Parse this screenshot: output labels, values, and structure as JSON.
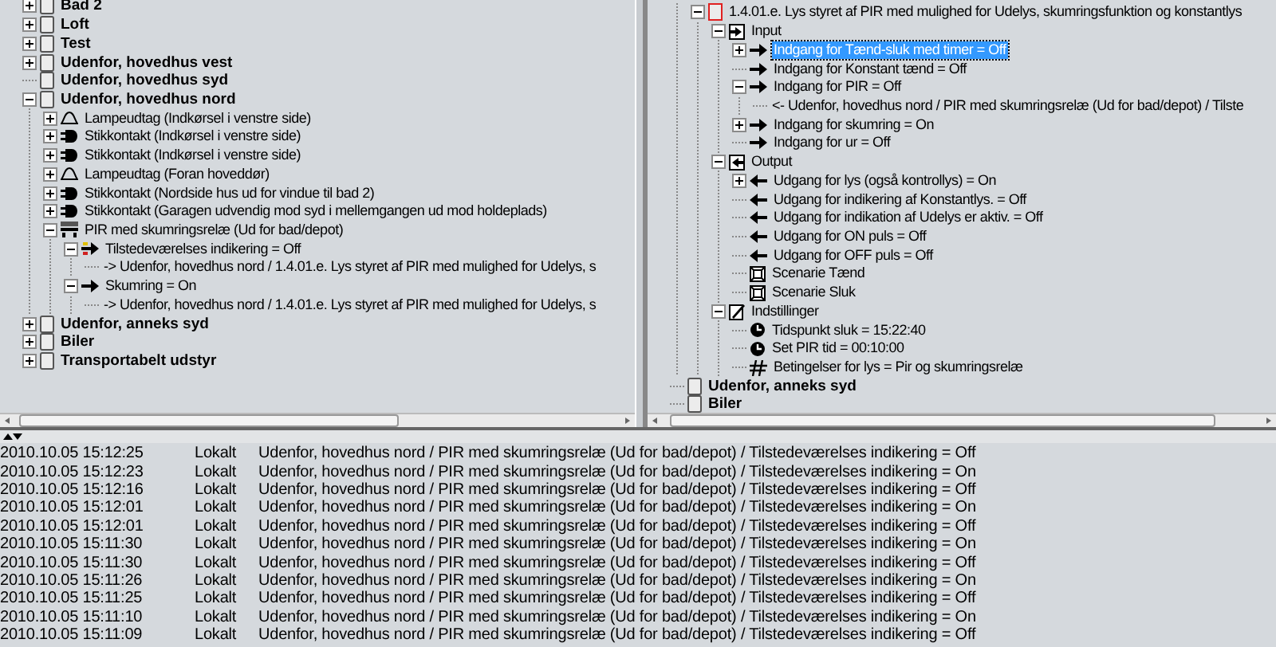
{
  "left_tree": [
    {
      "kind": "room",
      "label": "Bad 2",
      "expanded": false,
      "selected": false
    },
    {
      "kind": "room",
      "label": "Loft",
      "expanded": false,
      "selected": false
    },
    {
      "kind": "room",
      "label": "Test",
      "expanded": false,
      "selected": false
    },
    {
      "kind": "room",
      "label": "Udenfor, hovedhus vest",
      "expanded": false,
      "selected": false
    },
    {
      "kind": "room",
      "label": "Udenfor, hovedhus syd",
      "selected": false
    },
    {
      "kind": "room",
      "label": "Udenfor, hovedhus nord",
      "expanded": true,
      "selected": false,
      "children": [
        {
          "kind": "lamp",
          "label": "Lampeudtag (Indkørsel i venstre side)",
          "expanded": false,
          "selected": false
        },
        {
          "kind": "socket",
          "label": "Stikkontakt (Indkørsel i venstre side)",
          "expanded": false,
          "selected": false
        },
        {
          "kind": "socket",
          "label": "Stikkontakt (Indkørsel i venstre side)",
          "expanded": false,
          "selected": false
        },
        {
          "kind": "lamp",
          "label": "Lampeudtag (Foran hoveddør)",
          "expanded": false,
          "selected": false
        },
        {
          "kind": "socket",
          "label": "Stikkontakt (Nordside hus ud for vindue til bad 2)",
          "expanded": false,
          "selected": false
        },
        {
          "kind": "socket",
          "label": "Stikkontakt (Garagen udvendig mod syd i mellemgangen ud mod holdeplads)",
          "expanded": false,
          "selected": false
        },
        {
          "kind": "sensor",
          "label": "PIR med skumringsrelæ (Ud for bad/depot)",
          "expanded": true,
          "selected": false,
          "children": [
            {
              "kind": "presence",
              "label": "Tilstedeværelses indikering = Off",
              "expanded": true,
              "selected": false,
              "children": [
                {
                  "label": "-> Udenfor, hovedhus nord / 1.4.01.e. Lys styret af PIR med mulighed for Udelys, s",
                  "selected": false
                }
              ]
            },
            {
              "kind": "input",
              "label": "Skumring = On",
              "expanded": true,
              "selected": false,
              "children": [
                {
                  "label": "-> Udenfor, hovedhus nord / 1.4.01.e. Lys styret af PIR med mulighed for Udelys, s",
                  "selected": false
                }
              ]
            }
          ]
        }
      ]
    },
    {
      "kind": "room",
      "label": "Udenfor, anneks syd",
      "expanded": false,
      "selected": false
    },
    {
      "kind": "room",
      "label": "Biler",
      "expanded": false,
      "selected": false
    },
    {
      "kind": "room",
      "label": "Transportabelt udstyr",
      "expanded": false,
      "selected": false
    }
  ],
  "right_tree": [
    {
      "children": [
        {
          "kind": "module",
          "label": "1.4.01.e. Lys styret af PIR med mulighed for Udelys, skumringsfunktion og konstantlys",
          "expanded": true,
          "selected": false,
          "children": [
            {
              "kind": "input-group",
              "label": "Input",
              "expanded": true,
              "selected": false,
              "children": [
                {
                  "kind": "input",
                  "label": "Indgang for Tænd-sluk med timer = Off",
                  "expanded": false,
                  "selected": true
                },
                {
                  "kind": "input",
                  "label": "Indgang for Konstant tænd = Off",
                  "selected": false
                },
                {
                  "kind": "input",
                  "label": "Indgang for PIR = Off",
                  "expanded": true,
                  "selected": false,
                  "children": [
                    {
                      "label": "<- Udenfor, hovedhus nord / PIR med skumringsrelæ (Ud for bad/depot) / Tilste",
                      "selected": false
                    }
                  ]
                },
                {
                  "kind": "input",
                  "label": "Indgang for skumring = On",
                  "expanded": false,
                  "selected": false
                },
                {
                  "kind": "input",
                  "label": "Indgang for ur = Off",
                  "selected": false
                }
              ]
            },
            {
              "kind": "output-group",
              "label": "Output",
              "expanded": true,
              "selected": false,
              "children": [
                {
                  "kind": "output",
                  "label": "Udgang for lys (også kontrollys) = On",
                  "expanded": false,
                  "selected": false
                },
                {
                  "kind": "output",
                  "label": "Udgang for indikering af Konstantlys. = Off",
                  "selected": false
                },
                {
                  "kind": "output",
                  "label": "Udgang for indikation af Udelys er aktiv. = Off",
                  "selected": false
                },
                {
                  "kind": "output",
                  "label": "Udgang for ON puls = Off",
                  "selected": false
                },
                {
                  "kind": "output",
                  "label": "Udgang for OFF puls = Off",
                  "selected": false
                },
                {
                  "kind": "scene",
                  "label": "Scenarie Tænd",
                  "selected": false
                },
                {
                  "kind": "scene",
                  "label": "Scenarie Sluk",
                  "selected": false
                }
              ]
            },
            {
              "kind": "settings",
              "label": "Indstillinger",
              "expanded": true,
              "selected": false,
              "children": [
                {
                  "kind": "timer",
                  "label": "Tidspunkt sluk = 15:22:40",
                  "selected": false
                },
                {
                  "kind": "timer",
                  "label": "Set PIR tid = 00:10:00",
                  "selected": false
                },
                {
                  "kind": "condition",
                  "label": "Betingelser for lys = Pir og skumringsrelæ",
                  "selected": false
                }
              ]
            }
          ]
        }
      ]
    },
    {
      "kind": "room",
      "label": "Udenfor, anneks syd",
      "selected": false
    },
    {
      "kind": "room",
      "label": "Biler",
      "selected": false
    }
  ],
  "log": [
    {
      "time": "2010.10.05 15:12:25",
      "source": "Lokalt",
      "message": "Udenfor, hovedhus nord / PIR med skumringsrelæ (Ud for bad/depot) / Tilstedeværelses indikering = Off"
    },
    {
      "time": "2010.10.05 15:12:23",
      "source": "Lokalt",
      "message": "Udenfor, hovedhus nord / PIR med skumringsrelæ (Ud for bad/depot) / Tilstedeværelses indikering = On"
    },
    {
      "time": "2010.10.05 15:12:16",
      "source": "Lokalt",
      "message": "Udenfor, hovedhus nord / PIR med skumringsrelæ (Ud for bad/depot) / Tilstedeværelses indikering = Off"
    },
    {
      "time": "2010.10.05 15:12:01",
      "source": "Lokalt",
      "message": "Udenfor, hovedhus nord / PIR med skumringsrelæ (Ud for bad/depot) / Tilstedeværelses indikering = On"
    },
    {
      "time": "2010.10.05 15:12:01",
      "source": "Lokalt",
      "message": "Udenfor, hovedhus nord / PIR med skumringsrelæ (Ud for bad/depot) / Tilstedeværelses indikering = Off"
    },
    {
      "time": "2010.10.05 15:11:30",
      "source": "Lokalt",
      "message": "Udenfor, hovedhus nord / PIR med skumringsrelæ (Ud for bad/depot) / Tilstedeværelses indikering = On"
    },
    {
      "time": "2010.10.05 15:11:30",
      "source": "Lokalt",
      "message": "Udenfor, hovedhus nord / PIR med skumringsrelæ (Ud for bad/depot) / Tilstedeværelses indikering = Off"
    },
    {
      "time": "2010.10.05 15:11:26",
      "source": "Lokalt",
      "message": "Udenfor, hovedhus nord / PIR med skumringsrelæ (Ud for bad/depot) / Tilstedeværelses indikering = On"
    },
    {
      "time": "2010.10.05 15:11:25",
      "source": "Lokalt",
      "message": "Udenfor, hovedhus nord / PIR med skumringsrelæ (Ud for bad/depot) / Tilstedeværelses indikering = Off"
    },
    {
      "time": "2010.10.05 15:11:10",
      "source": "Lokalt",
      "message": "Udenfor, hovedhus nord / PIR med skumringsrelæ (Ud for bad/depot) / Tilstedeværelses indikering = On"
    },
    {
      "time": "2010.10.05 15:11:09",
      "source": "Lokalt",
      "message": "Udenfor, hovedhus nord / PIR med skumringsrelæ (Ud for bad/depot) / Tilstedeværelses indikering = Off"
    }
  ]
}
